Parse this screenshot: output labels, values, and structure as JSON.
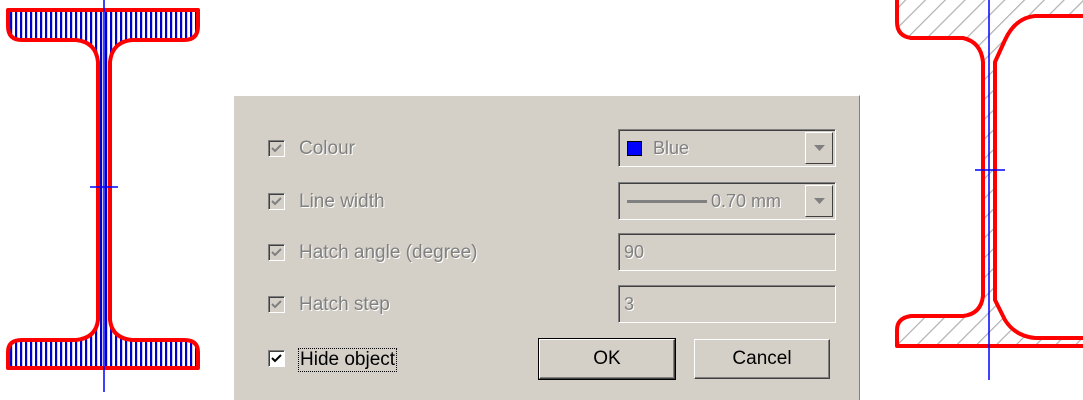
{
  "dialog": {
    "colour": {
      "label": "Colour",
      "checked": true,
      "enabled": false,
      "value": "Blue",
      "swatch_color": "#0000ff"
    },
    "line_width": {
      "label": "Line width",
      "checked": true,
      "enabled": false,
      "value": "0.70 mm"
    },
    "hatch_angle": {
      "label": "Hatch angle (degree)",
      "checked": true,
      "enabled": false,
      "value": "90"
    },
    "hatch_step": {
      "label": "Hatch step",
      "checked": true,
      "enabled": false,
      "value": "3"
    },
    "hide_object": {
      "label": "Hide object",
      "checked": true,
      "enabled": true
    },
    "ok_label": "OK",
    "cancel_label": "Cancel"
  },
  "colors": {
    "outline": "#ff0000",
    "hatch_left": "#0000cc",
    "axis": "#0000ff",
    "hatch_right": "#b0b0b0"
  }
}
